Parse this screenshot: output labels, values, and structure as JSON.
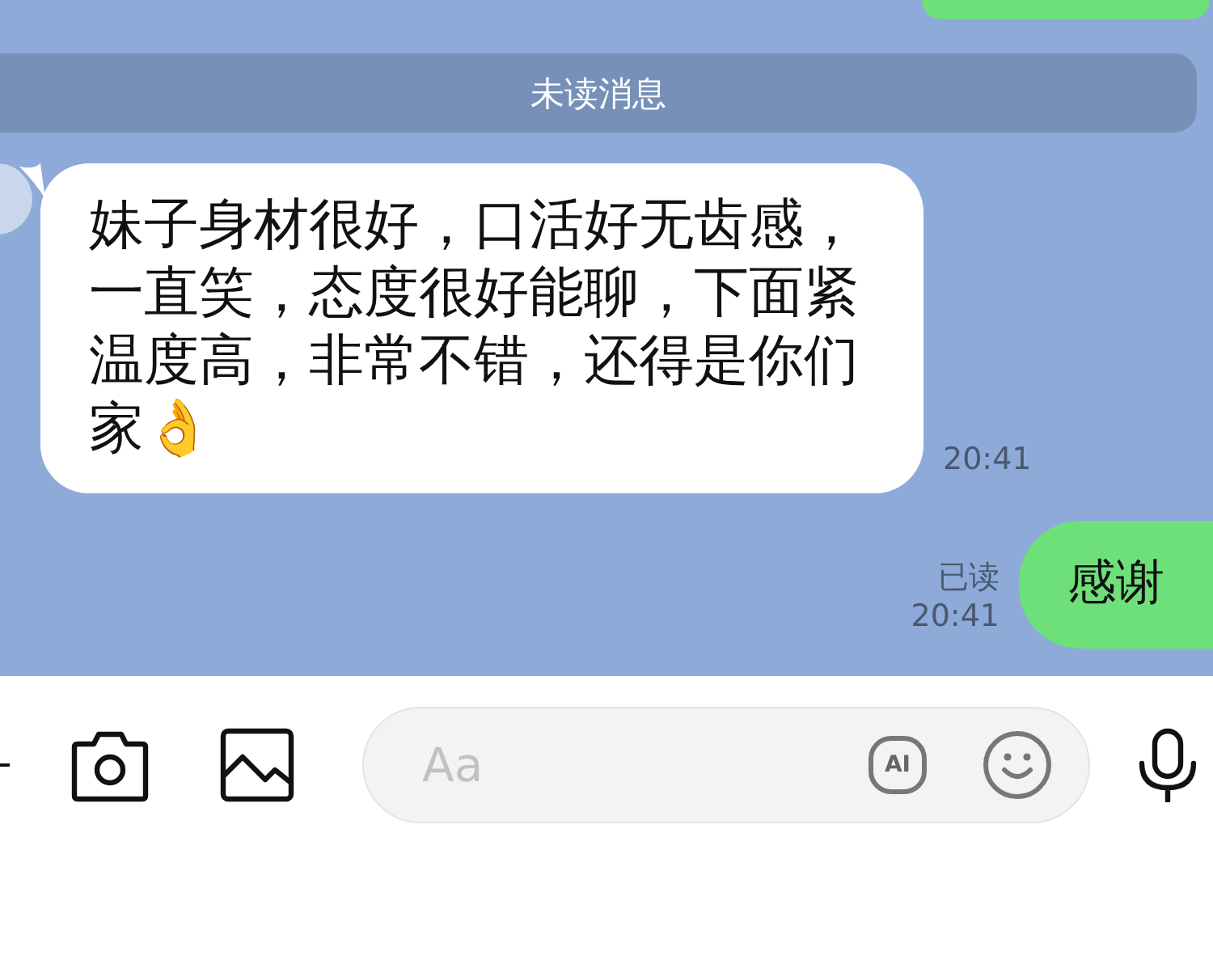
{
  "unread_divider": "未读消息",
  "messages": [
    {
      "kind": "incoming",
      "text": "妹子身材很好，口活好无齿感，一直笑，态度很好能聊，下面紧温度高，非常不错，还得是你们家👌",
      "time": "20:41"
    },
    {
      "kind": "outgoing",
      "text": "感谢",
      "read_label": "已读",
      "time": "20:41"
    }
  ],
  "composer": {
    "placeholder": "Aa",
    "ai_label": "AI"
  }
}
